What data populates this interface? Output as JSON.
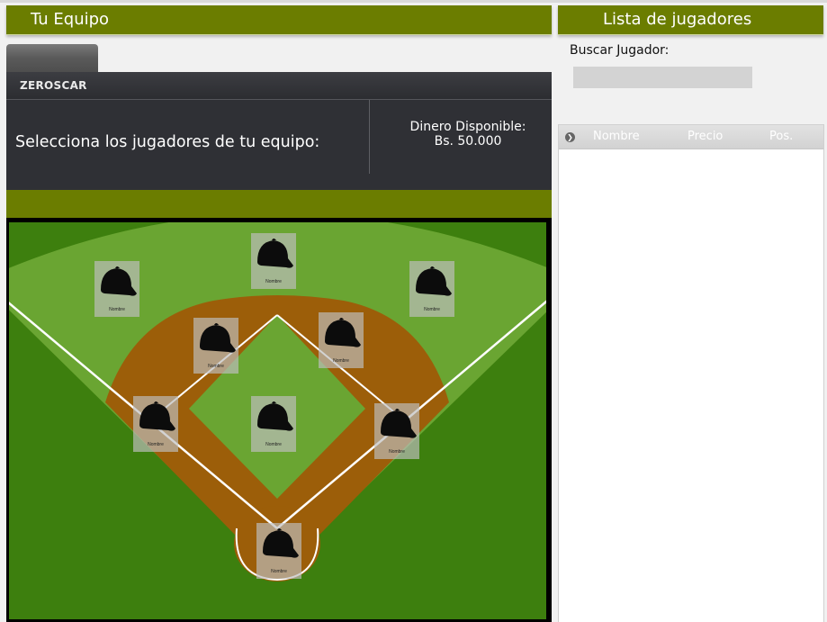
{
  "left_panel": {
    "title": "Tu Equipo",
    "team_name": "ZEROSCAR",
    "instruction": "Selecciona los jugadores de tu equipo:",
    "money_label": "Dinero Disponible:",
    "money_value": "Bs. 50.000"
  },
  "field": {
    "player_placeholder": "Nombre",
    "positions": [
      "LF",
      "CF",
      "RF",
      "3B",
      "SS",
      "2B",
      "1B",
      "P",
      "C"
    ],
    "icon": "baseball-cap-icon",
    "colors": {
      "outfield_dark": "#3d7f0e",
      "outfield_light": "#6aa532",
      "dirt": "#9c5e09",
      "lines": "#ffffff"
    }
  },
  "right_panel": {
    "title": "Lista de jugadores",
    "search_label": "Buscar Jugador:",
    "search_value": "",
    "columns": [
      "Nombre",
      "Precio",
      "Pos."
    ],
    "rows": []
  },
  "theme": {
    "header_olive": "#6b7d00",
    "team_box": "#2f3035"
  }
}
